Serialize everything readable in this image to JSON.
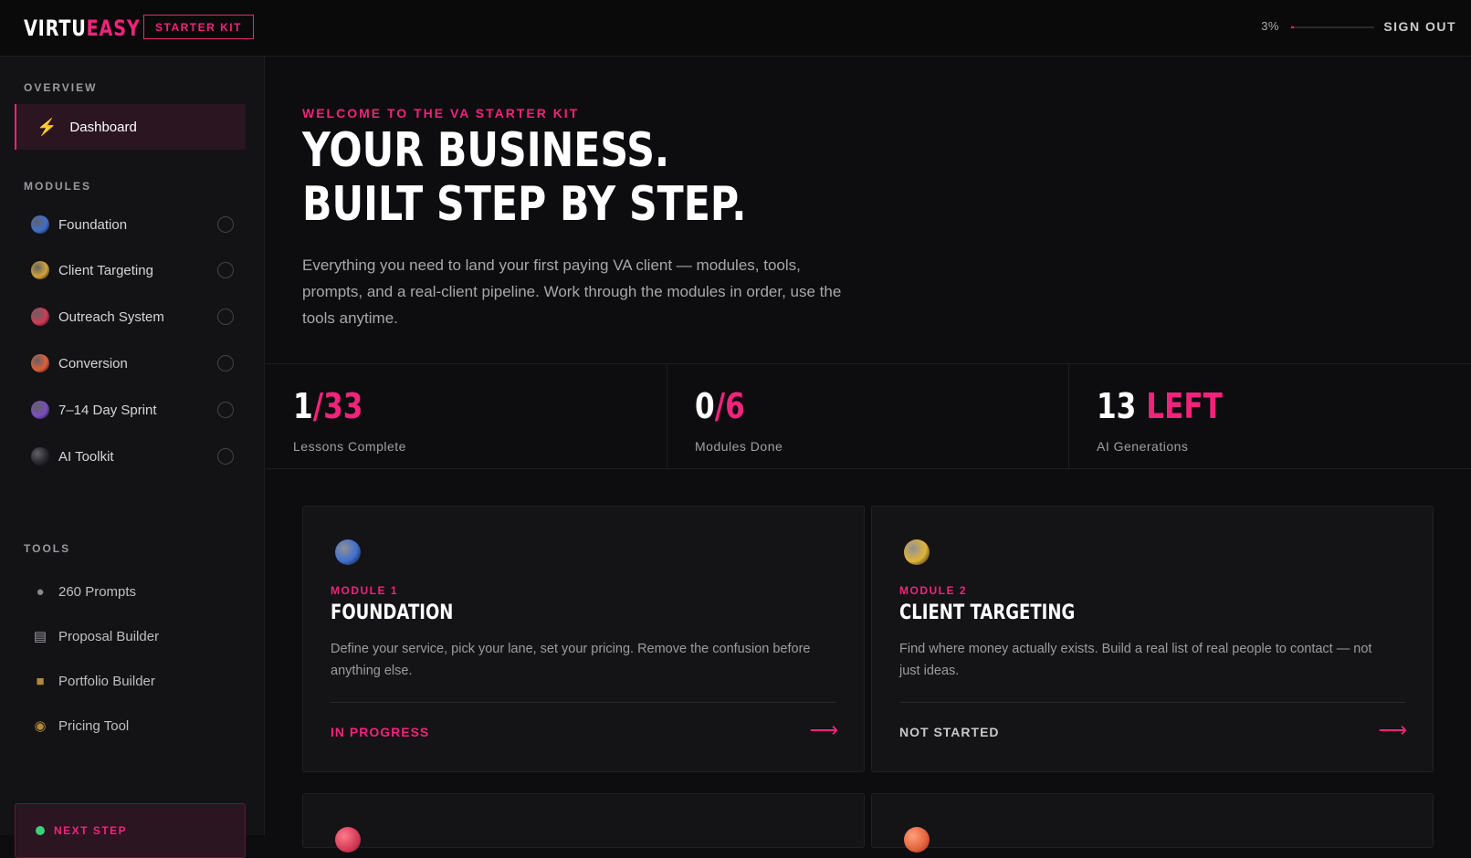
{
  "header": {
    "logo_part1": "VIRTU",
    "logo_part2": "EASY",
    "kit_badge": "STARTER KIT",
    "progress_text": "3%",
    "progress_value": 0.03,
    "signout_label": "SIGN OUT"
  },
  "sidebar": {
    "overview_label": "OVERVIEW",
    "dashboard_label": "Dashboard",
    "modules_label": "MODULES",
    "modules": [
      {
        "label": "Foundation",
        "color": "#3f6fd0"
      },
      {
        "label": "Client Targeting",
        "color": "#d4a43a"
      },
      {
        "label": "Outreach System",
        "color": "#d23a55"
      },
      {
        "label": "Conversion",
        "color": "#e0603a"
      },
      {
        "label": "7–14 Day Sprint",
        "color": "#7a4ec0"
      },
      {
        "label": "AI Toolkit",
        "color": "#2a2830"
      }
    ],
    "tools_label": "TOOLS",
    "tools": [
      {
        "label": "260 Prompts",
        "icon": "speech-bubble-icon"
      },
      {
        "label": "Proposal Builder",
        "icon": "document-icon"
      },
      {
        "label": "Portfolio Builder",
        "icon": "folder-icon"
      },
      {
        "label": "Pricing Tool",
        "icon": "money-bag-icon"
      }
    ],
    "next_step_label": "NEXT STEP"
  },
  "hero": {
    "welcome": "WELCOME TO THE VA STARTER KIT",
    "headline_line1": "YOUR BUSINESS.",
    "headline_line2": "BUILT STEP BY STEP.",
    "intro": "Everything you need to land your first paying VA client — modules, tools, prompts, and a real-client pipeline. Work through the modules in order, use the tools anytime."
  },
  "stats": [
    {
      "main": "1",
      "accent": "/33",
      "label": "Lessons Complete"
    },
    {
      "main": "0",
      "accent": "/6",
      "label": "Modules Done"
    },
    {
      "main": "13 ",
      "accent": "LEFT",
      "label": "AI Generations"
    }
  ],
  "cards": [
    {
      "module": "MODULE 1",
      "title": "FOUNDATION",
      "desc": "Define your service, pick your lane, set your pricing. Remove the confusion before anything else.",
      "status": "IN PROGRESS",
      "status_color": "#f0247a",
      "dot_color": "#3f6fd0"
    },
    {
      "module": "MODULE 2",
      "title": "CLIENT TARGETING",
      "desc": "Find where money actually exists. Build a real list of real people to contact — not just ideas.",
      "status": "NOT STARTED",
      "status_color": "#c8c8cc",
      "dot_color": "#e0b43a"
    }
  ],
  "colors": {
    "accent": "#f0247a",
    "background": "#0d0c0e"
  }
}
